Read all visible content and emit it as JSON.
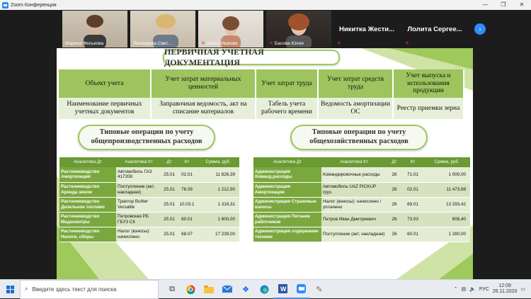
{
  "window": {
    "title": "Zoom Конференция",
    "controls": [
      "—",
      "❐",
      "✕"
    ]
  },
  "gallery": {
    "participants": [
      {
        "name": "Марина Феськова",
        "muted": false,
        "video": true
      },
      {
        "name": "Леонидова Свет...",
        "muted": false,
        "video": true
      },
      {
        "name": "Алеся Ишкова",
        "muted": true,
        "video": true
      },
      {
        "name": "Басова Юлия",
        "muted": true,
        "video": true
      },
      {
        "name": "Никитка Жести...",
        "muted": true,
        "video": false
      },
      {
        "name": "Лолита Сергее...",
        "muted": true,
        "video": false
      }
    ],
    "next_label": "›"
  },
  "slide": {
    "title": "ПЕРВИЧНАЯ УЧЕТНАЯ ДОКУМЕНТАЦИЯ",
    "top_table": {
      "headers": [
        "Объект учета",
        "Учет затрат материальных ценностей",
        "Учет затрат труда",
        "Учет затрат средств труда",
        "Учет выпуска и использования продукции"
      ],
      "row": [
        "Наименование первичных учетных документов",
        "Заправочная ведомость, акт на списание материалов",
        "Табель учета рабочего времени",
        "Ведомость амортизации ОС",
        "Реестр приемки зерна"
      ]
    },
    "left_title": "Типовые операции по учету общепроизводственных расходов",
    "right_title": "Типовые операции по учету общехозяйственных расходов",
    "left_table": {
      "headers": [
        "Аналитика Дт",
        "Аналитика Кт",
        "Дт",
        "Кт",
        "Сумма, руб."
      ],
      "rows": [
        [
          "Растениеводство Амортизация",
          "Автомобиль ГАЗ 417208",
          "25.01",
          "02.01",
          "11 826,39"
        ],
        [
          "Растениеводство Аренда земли",
          "Поступление (акт, накладная)",
          "25.01",
          "76.09",
          "1 212,90"
        ],
        [
          "Растениеводство Дизельное топливо",
          "Трактор Buhler Versatile",
          "25.01",
          "10.03.1",
          "1 318,31"
        ],
        [
          "Растениеводство Медосмотры",
          "Петровская РБ ГБУЗ СК",
          "25.01",
          "60.01",
          "1 600,00"
        ],
        [
          "Растениеводство Налоги, сборы",
          "Налог (взносы): начислено",
          "25.01",
          "68.07",
          "17 239,00"
        ]
      ]
    },
    "right_table": {
      "headers": [
        "Аналитика Дт",
        "Аналитика Кт",
        "Дт",
        "Кт",
        "Сумма, руб."
      ],
      "rows": [
        [
          "Администрация Команд.расходы",
          "Командировочные расходы",
          "26",
          "71.01",
          "1 000,00"
        ],
        [
          "Администрация Амортизация",
          "Автомобиль UAZ PICKUP груз.",
          "26",
          "02.01",
          "11 473,68"
        ],
        [
          "Администрация Страховые взносы",
          "Налог (взносы): начислено / уплачено",
          "26",
          "69.01",
          "13 293,42"
        ],
        [
          "Администрация Питание работников",
          "Петров Иван Дмитриевич",
          "26",
          "73.03",
          "608,40"
        ],
        [
          "Администрация содержание техники",
          "Поступление (акт, накладная)",
          "26",
          "60.01",
          "1 280,00"
        ]
      ]
    }
  },
  "taskbar": {
    "search_placeholder": "Введите здесь текст для поиска",
    "language": "РУС",
    "time": "12:09",
    "date": "26.11.2020",
    "apps": [
      "task-view",
      "chrome",
      "file-explorer",
      "mail",
      "dropbox",
      "edge",
      "word",
      "zoom",
      "paint"
    ],
    "colors": {
      "accent": "#9dc45e",
      "dark_green": "#6a9a32"
    }
  }
}
